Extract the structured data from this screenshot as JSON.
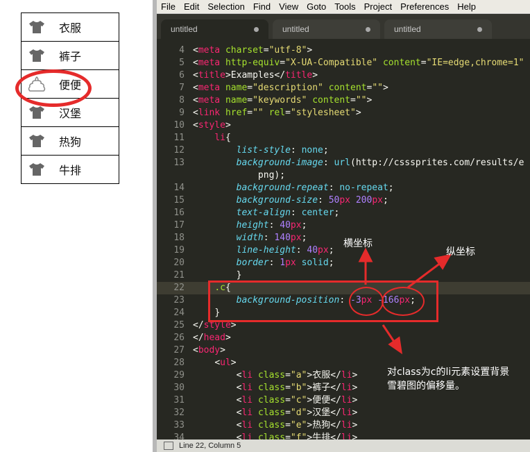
{
  "preview": {
    "items": [
      {
        "label": "衣服",
        "icon": "tshirt-icon"
      },
      {
        "label": "裤子",
        "icon": "tshirt-icon"
      },
      {
        "label": "便便",
        "icon": "poop-icon"
      },
      {
        "label": "汉堡",
        "icon": "tshirt-icon"
      },
      {
        "label": "热狗",
        "icon": "tshirt-icon"
      },
      {
        "label": "牛排",
        "icon": "tshirt-icon"
      }
    ]
  },
  "menubar": [
    "File",
    "Edit",
    "Selection",
    "Find",
    "View",
    "Goto",
    "Tools",
    "Project",
    "Preferences",
    "Help"
  ],
  "tabs": [
    {
      "label": "untitled"
    },
    {
      "label": "untitled"
    },
    {
      "label": "untitled"
    }
  ],
  "code_lines": [
    {
      "n": "4",
      "html": "<span class='k-plain'>&lt;</span><span class='k-tag'>meta</span> <span class='k-attr'>charset</span><span class='k-plain'>=</span><span class='k-str'>\"utf-8\"</span><span class='k-plain'>&gt;</span>"
    },
    {
      "n": "5",
      "html": "<span class='k-plain'>&lt;</span><span class='k-tag'>meta</span> <span class='k-attr'>http-equiv</span><span class='k-plain'>=</span><span class='k-str'>\"X-UA-Compatible\"</span> <span class='k-attr'>content</span><span class='k-plain'>=</span><span class='k-str'>\"IE=edge,chrome=1\"</span>"
    },
    {
      "n": "6",
      "html": "<span class='k-plain'>&lt;</span><span class='k-tag'>title</span><span class='k-plain'>&gt;Examples&lt;/</span><span class='k-tag'>title</span><span class='k-plain'>&gt;</span>"
    },
    {
      "n": "7",
      "html": "<span class='k-plain'>&lt;</span><span class='k-tag'>meta</span> <span class='k-attr'>name</span><span class='k-plain'>=</span><span class='k-str'>\"description\"</span> <span class='k-attr'>content</span><span class='k-plain'>=</span><span class='k-str'>\"\"</span><span class='k-plain'>&gt;</span>"
    },
    {
      "n": "8",
      "html": "<span class='k-plain'>&lt;</span><span class='k-tag'>meta</span> <span class='k-attr'>name</span><span class='k-plain'>=</span><span class='k-str'>\"keywords\"</span> <span class='k-attr'>content</span><span class='k-plain'>=</span><span class='k-str'>\"\"</span><span class='k-plain'>&gt;</span>"
    },
    {
      "n": "9",
      "html": "<span class='k-plain'>&lt;</span><span class='k-tag'>link</span> <span class='k-attr'>href</span><span class='k-plain'>=</span><span class='k-str'>\"\"</span> <span class='k-attr'>rel</span><span class='k-plain'>=</span><span class='k-str'>\"stylesheet\"</span><span class='k-plain'>&gt;</span>"
    },
    {
      "n": "10",
      "html": "<span class='k-plain'>&lt;</span><span class='k-tag'>style</span><span class='k-plain'>&gt;</span>"
    },
    {
      "n": "11",
      "html": "    <span class='k-tag'>li</span><span class='k-plain'>{</span>"
    },
    {
      "n": "12",
      "html": "        <span class='k-prop'>list-style</span><span class='k-plain'>: </span><span class='k-val'>none</span><span class='k-plain'>;</span>"
    },
    {
      "n": "13",
      "html": "        <span class='k-prop'>background-image</span><span class='k-plain'>: </span><span class='k-val'>url</span><span class='k-plain'>(http://csssprites.com/results/e</span>"
    },
    {
      "n": "",
      "html": "            <span class='k-plain'>png);</span>"
    },
    {
      "n": "14",
      "html": "        <span class='k-prop'>background-repeat</span><span class='k-plain'>: </span><span class='k-val'>no-repeat</span><span class='k-plain'>;</span>"
    },
    {
      "n": "15",
      "html": "        <span class='k-prop'>background-size</span><span class='k-plain'>: </span><span class='k-num'>50</span><span class='k-unit'>px</span> <span class='k-num'>200</span><span class='k-unit'>px</span><span class='k-plain'>;</span>"
    },
    {
      "n": "16",
      "html": "        <span class='k-prop'>text-align</span><span class='k-plain'>: </span><span class='k-val'>center</span><span class='k-plain'>;</span>"
    },
    {
      "n": "17",
      "html": "        <span class='k-prop'>height</span><span class='k-plain'>: </span><span class='k-num'>40</span><span class='k-unit'>px</span><span class='k-plain'>;</span>"
    },
    {
      "n": "18",
      "html": "        <span class='k-prop'>width</span><span class='k-plain'>: </span><span class='k-num'>140</span><span class='k-unit'>px</span><span class='k-plain'>;</span>"
    },
    {
      "n": "19",
      "html": "        <span class='k-prop'>line-height</span><span class='k-plain'>: </span><span class='k-num'>40</span><span class='k-unit'>px</span><span class='k-plain'>;</span>"
    },
    {
      "n": "20",
      "html": "        <span class='k-prop'>border</span><span class='k-plain'>: </span><span class='k-num'>1</span><span class='k-unit'>px</span> <span class='k-val'>solid</span><span class='k-plain'>;</span>"
    },
    {
      "n": "21",
      "html": "        <span class='k-plain'>}</span>"
    },
    {
      "n": "22",
      "html": "    <span class='k-sel'>.c</span><span class='k-plain'>{</span>",
      "current": true
    },
    {
      "n": "23",
      "html": "        <span class='k-prop'>background-position</span><span class='k-plain'>: </span><span class='k-num'>-3</span><span class='k-unit'>px</span> <span class='k-num'>-166</span><span class='k-unit'>px</span><span class='k-plain'>;</span>"
    },
    {
      "n": "24",
      "html": "    <span class='k-plain'>}</span>"
    },
    {
      "n": "25",
      "html": "<span class='k-plain'>&lt;/</span><span class='k-tag'>style</span><span class='k-plain'>&gt;</span>"
    },
    {
      "n": "26",
      "html": "<span class='k-plain'>&lt;/</span><span class='k-tag'>head</span><span class='k-plain'>&gt;</span>"
    },
    {
      "n": "27",
      "html": "<span class='k-plain'>&lt;</span><span class='k-tag'>body</span><span class='k-plain'>&gt;</span>"
    },
    {
      "n": "28",
      "html": "    <span class='k-plain'>&lt;</span><span class='k-tag'>ul</span><span class='k-plain'>&gt;</span>"
    },
    {
      "n": "29",
      "html": "        <span class='k-plain'>&lt;</span><span class='k-tag'>li</span> <span class='k-attr'>class</span><span class='k-plain'>=</span><span class='k-str'>\"a\"</span><span class='k-plain'>&gt;衣服&lt;/</span><span class='k-tag'>li</span><span class='k-plain'>&gt;</span>"
    },
    {
      "n": "30",
      "html": "        <span class='k-plain'>&lt;</span><span class='k-tag'>li</span> <span class='k-attr'>class</span><span class='k-plain'>=</span><span class='k-str'>\"b\"</span><span class='k-plain'>&gt;裤子&lt;/</span><span class='k-tag'>li</span><span class='k-plain'>&gt;</span>"
    },
    {
      "n": "31",
      "html": "        <span class='k-plain'>&lt;</span><span class='k-tag'>li</span> <span class='k-attr'>class</span><span class='k-plain'>=</span><span class='k-str'>\"c\"</span><span class='k-plain'>&gt;便便&lt;/</span><span class='k-tag'>li</span><span class='k-plain'>&gt;</span>"
    },
    {
      "n": "32",
      "html": "        <span class='k-plain'>&lt;</span><span class='k-tag'>li</span> <span class='k-attr'>class</span><span class='k-plain'>=</span><span class='k-str'>\"d\"</span><span class='k-plain'>&gt;汉堡&lt;/</span><span class='k-tag'>li</span><span class='k-plain'>&gt;</span>"
    },
    {
      "n": "33",
      "html": "        <span class='k-plain'>&lt;</span><span class='k-tag'>li</span> <span class='k-attr'>class</span><span class='k-plain'>=</span><span class='k-str'>\"e\"</span><span class='k-plain'>&gt;热狗&lt;/</span><span class='k-tag'>li</span><span class='k-plain'>&gt;</span>"
    },
    {
      "n": "34",
      "html": "        <span class='k-plain'>&lt;</span><span class='k-tag'>li</span> <span class='k-attr'>class</span><span class='k-plain'>=</span><span class='k-str'>\"f\"</span><span class='k-plain'>&gt;牛排&lt;/</span><span class='k-tag'>li</span><span class='k-plain'>&gt;</span>"
    }
  ],
  "statusbar": {
    "text": "Line 22, Column 5"
  },
  "annotations": {
    "x_label": "横坐标",
    "y_label": "纵坐标",
    "note_line1": "对class为c的li元素设置背景",
    "note_line2": "雪碧图的偏移量。",
    "accent_color": "#e52b2b"
  }
}
